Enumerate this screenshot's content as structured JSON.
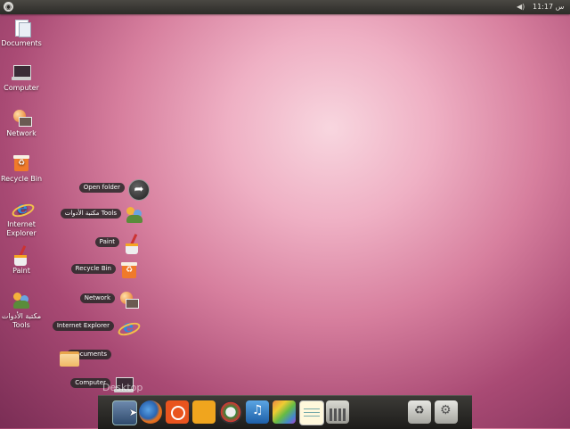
{
  "top_panel": {
    "clock": "س 11:17"
  },
  "desktop_icons": [
    {
      "label": "Documents",
      "icon": "documents-icon"
    },
    {
      "label": "Computer",
      "icon": "computer-icon"
    },
    {
      "label": "Network",
      "icon": "network-icon"
    },
    {
      "label": "Recycle Bin",
      "icon": "recycle-bin-icon"
    },
    {
      "label": "Internet Explorer",
      "icon": "internet-explorer-icon"
    },
    {
      "label": "Paint",
      "icon": "paint-icon"
    },
    {
      "label": "مكتبة الأدوات Tools",
      "icon": "tools-icon"
    }
  ],
  "stack": {
    "items": [
      {
        "label": "Open folder"
      },
      {
        "label": "مكتبة الأدوات Tools"
      },
      {
        "label": "Paint"
      },
      {
        "label": "Recycle Bin"
      },
      {
        "label": "Network"
      },
      {
        "label": "Internet Explorer"
      },
      {
        "label": "Documents"
      },
      {
        "label": "Computer"
      }
    ],
    "caption": "Desktop"
  },
  "dock": {
    "items": [
      {
        "icon": "desktop-stack-icon"
      },
      {
        "icon": "firefox-icon"
      },
      {
        "icon": "ubuntu-icon"
      },
      {
        "icon": "people-icon"
      },
      {
        "icon": "app-icon"
      },
      {
        "icon": "itunes-icon"
      },
      {
        "icon": "paint-palette-icon"
      },
      {
        "icon": "notepad-icon"
      },
      {
        "icon": "calculator-icon"
      },
      {
        "icon": "recycle-icon"
      },
      {
        "icon": "settings-gear-icon"
      }
    ]
  }
}
